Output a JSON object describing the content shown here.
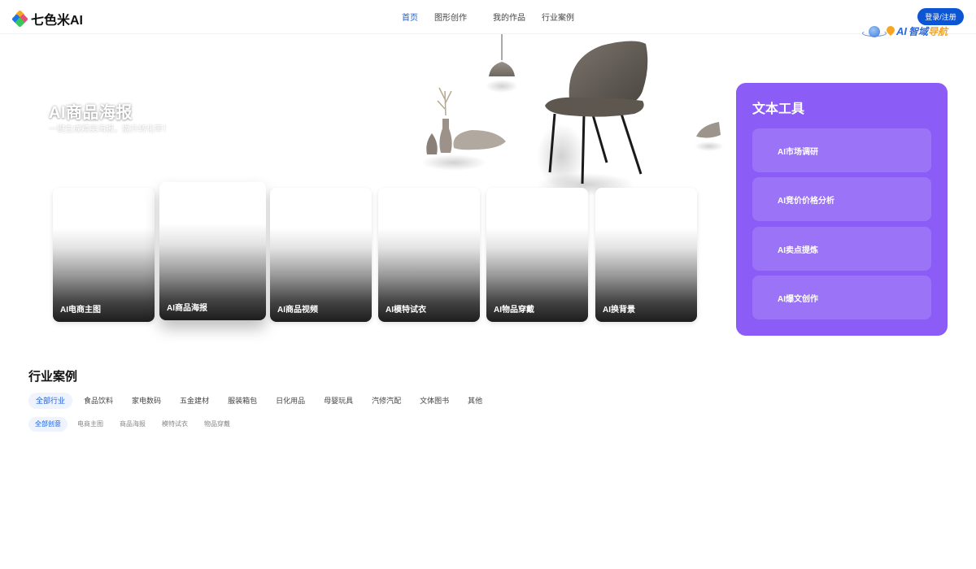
{
  "header": {
    "logo_text": "七色米AI",
    "nav": [
      {
        "label": "首页",
        "active": true
      },
      {
        "label": "图形创作",
        "active": false
      },
      {
        "label": "我的作品",
        "active": false
      },
      {
        "label": "行业案例",
        "active": false
      }
    ],
    "login_label": "登录/注册",
    "brand_badge": {
      "ai": "AI",
      "cn_main": "智域",
      "cn_accent": "导航"
    }
  },
  "hero": {
    "title": "AI商品海报",
    "subtitle": "一键生成精美海报，提升转化率！"
  },
  "cards": [
    {
      "label": "AI电商主图"
    },
    {
      "label": "AI商品海报"
    },
    {
      "label": "AI商品视频"
    },
    {
      "label": "AI模特试衣"
    },
    {
      "label": "AI物品穿戴"
    },
    {
      "label": "AI换背景"
    }
  ],
  "text_tools": {
    "title": "文本工具",
    "items": [
      {
        "label": "AI市场调研"
      },
      {
        "label": "AI竞价价格分析"
      },
      {
        "label": "AI卖点提炼"
      },
      {
        "label": "AI爆文创作"
      }
    ]
  },
  "industry": {
    "title": "行业案例",
    "categories": [
      {
        "label": "全部行业",
        "active": true
      },
      {
        "label": "食品饮料"
      },
      {
        "label": "家电数码"
      },
      {
        "label": "五金建材"
      },
      {
        "label": "服装箱包"
      },
      {
        "label": "日化用品"
      },
      {
        "label": "母婴玩具"
      },
      {
        "label": "汽修汽配"
      },
      {
        "label": "文体图书"
      },
      {
        "label": "其他"
      }
    ],
    "types": [
      {
        "label": "全部创意",
        "active": true
      },
      {
        "label": "电商主图"
      },
      {
        "label": "商品海报"
      },
      {
        "label": "模特试衣"
      },
      {
        "label": "物品穿戴"
      }
    ]
  },
  "colors": {
    "accent": "#0c55d4",
    "panel": "#8b5cf6"
  }
}
